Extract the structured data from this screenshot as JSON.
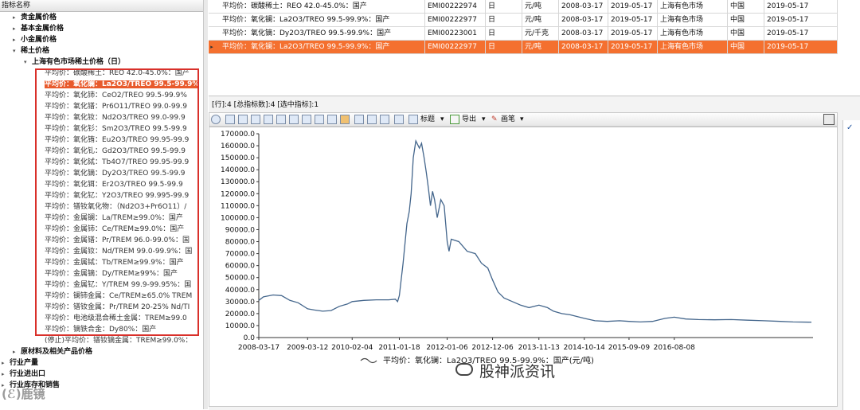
{
  "tree": {
    "header": "指标名称",
    "nodes": [
      {
        "label": "贵金属价格",
        "level": 1,
        "arrow": "▸",
        "bold": true
      },
      {
        "label": "基本金属价格",
        "level": 1,
        "arrow": "▸",
        "bold": true
      },
      {
        "label": "小金属价格",
        "level": 1,
        "arrow": "▸",
        "bold": true
      },
      {
        "label": "稀土价格",
        "level": 1,
        "arrow": "▾",
        "bold": true
      },
      {
        "label": "上海有色市场稀土价格（日）",
        "level": 2,
        "arrow": "▾",
        "bold": true
      },
      {
        "label": "平均价：碳酸稀土：REO 42.0-45.0%：国产",
        "level": 3
      },
      {
        "label": "平均价：氧化镧：La2O3/TREO 99.5-99.9%",
        "level": 3,
        "selected": true
      },
      {
        "label": "平均价：氧化铈：CeO2/TREO 99.5-99.9%",
        "level": 3
      },
      {
        "label": "平均价：氧化镨：Pr6O11/TREO 99.0-99.9",
        "level": 3
      },
      {
        "label": "平均价：氧化钕：Nd2O3/TREO 99.0-99.9",
        "level": 3
      },
      {
        "label": "平均价：氧化钐：Sm2O3/TREO 99.5-99.9",
        "level": 3
      },
      {
        "label": "平均价：氧化铕：Eu2O3/TREO 99.95-99.9",
        "level": 3
      },
      {
        "label": "平均价：氧化钆：Gd2O3/TREO 99.5-99.9",
        "level": 3
      },
      {
        "label": "平均价：氧化铽：Tb4O7/TREO 99.95-99.9",
        "level": 3
      },
      {
        "label": "平均价：氧化镝：Dy2O3/TREO 99.5-99.9",
        "level": 3
      },
      {
        "label": "平均价：氧化铒：Er2O3/TREO 99.5-99.9",
        "level": 3
      },
      {
        "label": "平均价：氧化钇：Y2O3/TREO 99.995-99.9",
        "level": 3
      },
      {
        "label": "平均价：镨钕氧化物：（Nd2O3+Pr6O11）/",
        "level": 3
      },
      {
        "label": "平均价：金属镧：La/TREM≥99.0%：国产",
        "level": 3
      },
      {
        "label": "平均价：金属铈：Ce/TREM≥99.0%：国产",
        "level": 3
      },
      {
        "label": "平均价：金属镨：Pr/TREM 96.0-99.0%：国",
        "level": 3
      },
      {
        "label": "平均价：金属钕：Nd/TREM 99.0-99.9%：国",
        "level": 3
      },
      {
        "label": "平均价：金属铽：Tb/TREM≥99.9%：国产",
        "level": 3
      },
      {
        "label": "平均价：金属镝：Dy/TREM≥99%：国产",
        "level": 3
      },
      {
        "label": "平均价：金属钇：Y/TREM 99.9-99.95%：国",
        "level": 3
      },
      {
        "label": "平均价：镧铈金属：Ce/TREM≥65.0% TREM",
        "level": 3
      },
      {
        "label": "平均价：镨钕金属：Pr/TREM 20-25% Nd/TI",
        "level": 3
      },
      {
        "label": "平均价：电池级混合稀土金属：TREM≥99.0",
        "level": 3
      },
      {
        "label": "平均价：镝铁合金：Dy80%：国产",
        "level": 3
      },
      {
        "label": "(停止)平均价：镨钕镝金属：TREM≥99.0%：",
        "level": 3
      },
      {
        "label": "原材料及相关产品价格",
        "level": 1,
        "arrow": "▸",
        "bold": true
      },
      {
        "label": "行业产量",
        "level": 0,
        "arrow": "▸",
        "bold": true
      },
      {
        "label": "行业进出口",
        "level": 0,
        "arrow": "▸",
        "bold": true
      },
      {
        "label": "行业库存和销售",
        "level": 0,
        "arrow": "▸",
        "bold": true
      }
    ],
    "watermark": "(ℰ)鹿镜"
  },
  "grid": {
    "rows": [
      {
        "name": "平均价：碳酸稀土：REO 42.0-45.0%：国产",
        "code": "EMI00222974",
        "freq": "日",
        "unit": "元/吨",
        "start": "2008-03-17",
        "end": "2019-05-17",
        "source": "上海有色市场",
        "region": "中国",
        "update": "2019-05-17"
      },
      {
        "name": "平均价：氧化镧：La2O3/TREO 99.5-99.9%：国产",
        "code": "EMI00222977",
        "freq": "日",
        "unit": "元/吨",
        "start": "2008-03-17",
        "end": "2019-05-17",
        "source": "上海有色市场",
        "region": "中国",
        "update": "2019-05-17"
      },
      {
        "name": "平均价：氧化镝：Dy2O3/TREO 99.5-99.9%：国产",
        "code": "EMI00223001",
        "freq": "日",
        "unit": "元/千克",
        "start": "2008-03-17",
        "end": "2019-05-17",
        "source": "上海有色市场",
        "region": "中国",
        "update": "2019-05-17"
      },
      {
        "name": "平均价：氧化镧：La2O3/TREO 99.5-99.9%：国产",
        "code": "EMI00222977",
        "freq": "日",
        "unit": "元/吨",
        "start": "2008-03-17",
        "end": "2019-05-17",
        "source": "上海有色市场",
        "region": "中国",
        "update": "2019-05-17",
        "selected": true
      }
    ],
    "row_marker": "▸"
  },
  "status": {
    "text": "[行]:4 [总指标数]:4 [选中指标]:1"
  },
  "toolbar": {
    "title_label": "标题",
    "export_label": "导出",
    "draw_label": "画笔"
  },
  "right_panel": {
    "check": "✓"
  },
  "chart_data": {
    "type": "line",
    "ylim": [
      0,
      170000
    ],
    "yticks": [
      "0.0",
      "10000.0",
      "20000.0",
      "30000.0",
      "40000.0",
      "50000.0",
      "60000.0",
      "70000.0",
      "80000.0",
      "90000.0",
      "100000.0",
      "110000.0",
      "120000.0",
      "130000.0",
      "140000.0",
      "150000.0",
      "160000.0",
      "170000.0"
    ],
    "xticks": [
      "2008-03-17",
      "2009-03-12",
      "2010-02-04",
      "2011-01-18",
      "2012-01-06",
      "2012-12-06",
      "2013-11-13",
      "2014-10-14",
      "2015-09-09",
      "2016-08-08"
    ],
    "line_color": "#44668c",
    "series": [
      {
        "name": "平均价：氧化镧：La2O3/TREO  99.5-99.9%：国产(元/吨)",
        "points": [
          [
            "2008-03-17",
            31000
          ],
          [
            "2008-04-20",
            34000
          ],
          [
            "2008-07-01",
            35500
          ],
          [
            "2008-09-01",
            35000
          ],
          [
            "2008-11-01",
            31000
          ],
          [
            "2009-01-01",
            29000
          ],
          [
            "2009-03-12",
            24000
          ],
          [
            "2009-05-01",
            23000
          ],
          [
            "2009-07-01",
            22000
          ],
          [
            "2009-09-01",
            22500
          ],
          [
            "2009-11-01",
            26000
          ],
          [
            "2010-01-01",
            28000
          ],
          [
            "2010-02-04",
            30000
          ],
          [
            "2010-05-01",
            31000
          ],
          [
            "2010-08-01",
            31500
          ],
          [
            "2010-11-01",
            31500
          ],
          [
            "2010-12-20",
            32000
          ],
          [
            "2011-01-05",
            30000
          ],
          [
            "2011-01-18",
            35000
          ],
          [
            "2011-02-15",
            62000
          ],
          [
            "2011-03-15",
            95000
          ],
          [
            "2011-04-01",
            105000
          ],
          [
            "2011-04-15",
            120000
          ],
          [
            "2011-05-01",
            150000
          ],
          [
            "2011-05-20",
            164000
          ],
          [
            "2011-06-15",
            158000
          ],
          [
            "2011-07-01",
            162000
          ],
          [
            "2011-07-20",
            150000
          ],
          [
            "2011-08-05",
            138000
          ],
          [
            "2011-08-20",
            125000
          ],
          [
            "2011-09-05",
            110000
          ],
          [
            "2011-09-20",
            122000
          ],
          [
            "2011-10-05",
            115000
          ],
          [
            "2011-10-25",
            100000
          ],
          [
            "2011-11-20",
            115000
          ],
          [
            "2011-12-15",
            110000
          ],
          [
            "2012-01-06",
            80000
          ],
          [
            "2012-01-20",
            72000
          ],
          [
            "2012-02-05",
            82000
          ],
          [
            "2012-04-01",
            80000
          ],
          [
            "2012-06-01",
            72000
          ],
          [
            "2012-08-01",
            70000
          ],
          [
            "2012-09-15",
            62000
          ],
          [
            "2012-11-01",
            58000
          ],
          [
            "2012-12-06",
            48000
          ],
          [
            "2013-01-15",
            38000
          ],
          [
            "2013-03-01",
            33000
          ],
          [
            "2013-05-01",
            30000
          ],
          [
            "2013-07-01",
            27000
          ],
          [
            "2013-09-01",
            25000
          ],
          [
            "2013-11-13",
            27000
          ],
          [
            "2014-01-15",
            25000
          ],
          [
            "2014-03-01",
            22000
          ],
          [
            "2014-05-01",
            20000
          ],
          [
            "2014-07-01",
            19000
          ],
          [
            "2014-10-14",
            16000
          ],
          [
            "2015-01-01",
            14000
          ],
          [
            "2015-04-01",
            13500
          ],
          [
            "2015-07-01",
            14000
          ],
          [
            "2015-09-09",
            13500
          ],
          [
            "2015-12-01",
            13000
          ],
          [
            "2016-03-01",
            13500
          ],
          [
            "2016-06-01",
            16000
          ],
          [
            "2016-08-08",
            17000
          ],
          [
            "2016-11-01",
            15500
          ],
          [
            "2017-02-01",
            15000
          ],
          [
            "2017-06-01",
            14800
          ],
          [
            "2017-10-01",
            15000
          ],
          [
            "2018-02-01",
            14500
          ],
          [
            "2018-06-01",
            14000
          ],
          [
            "2018-10-01",
            13500
          ],
          [
            "2019-01-01",
            13000
          ],
          [
            "2019-05-17",
            12800
          ]
        ]
      }
    ]
  },
  "watermark": {
    "text": "股神派资讯"
  }
}
